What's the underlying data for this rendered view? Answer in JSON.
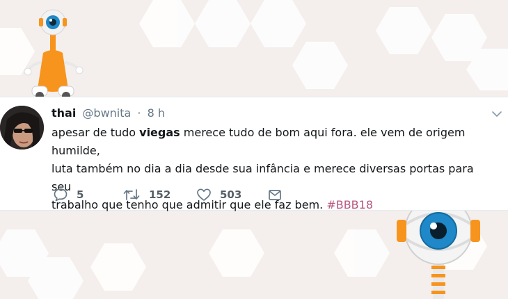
{
  "tweet": {
    "display_name": "thai",
    "handle": "@bwnita",
    "separator": "·",
    "time": "8 h",
    "text_line1_pre": "apesar de tudo ",
    "text_line1_bold": "viegas",
    "text_line1_post": " merece tudo de bom aqui fora. ele vem de origem humilde,",
    "text_line2": "luta também no dia a dia desde sua infância e merece diversas portas para seu",
    "text_line3": "trabalho que tenho que admitir que ele faz bem. ",
    "hashtag": "#BBB18"
  },
  "actions": {
    "reply_count": "5",
    "retweet_count": "152",
    "like_count": "503"
  },
  "icons": {
    "reply": "reply-icon",
    "retweet": "retweet-icon",
    "like": "heart-icon",
    "dm": "envelope-icon",
    "menu": "chevron-down-icon"
  },
  "colors": {
    "hashtag": "#b8577f",
    "text": "#14171a",
    "meta": "#657786",
    "background": "#f4efec",
    "mascot_orange": "#f7941d",
    "eye_blue": "#1e88c8"
  }
}
